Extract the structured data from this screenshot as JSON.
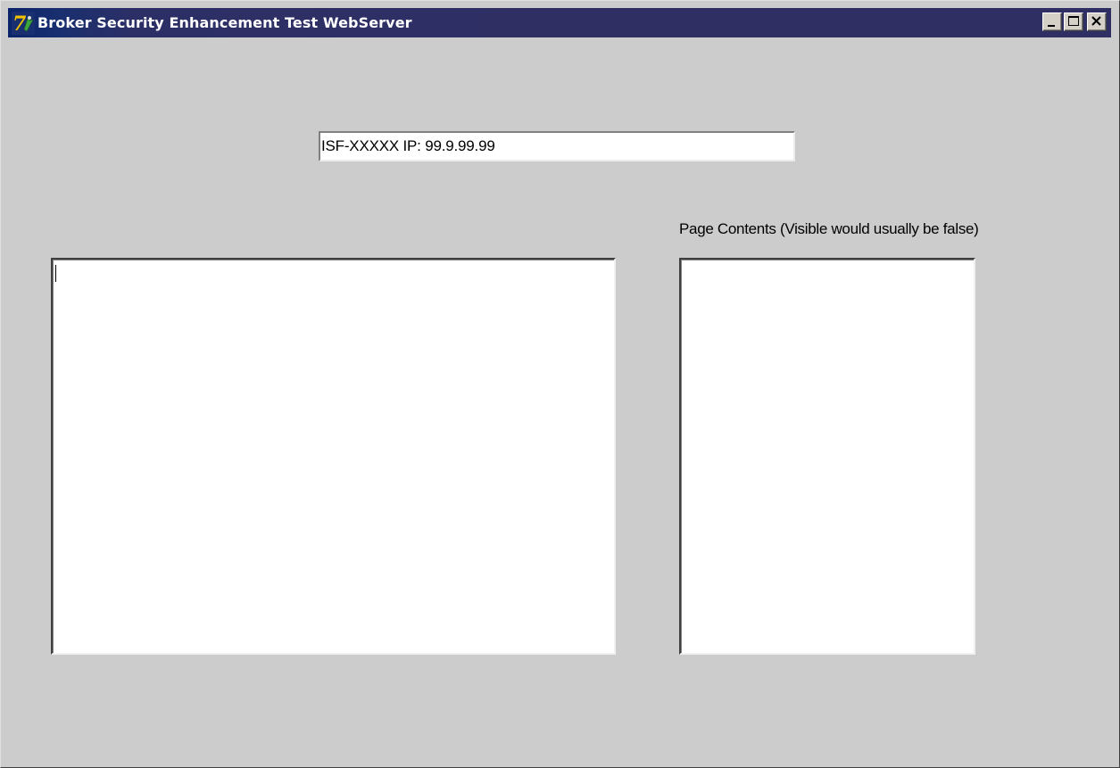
{
  "window": {
    "title": "Broker Security Enhancement Test WebServer",
    "icon": "app-icon"
  },
  "caption_buttons": {
    "minimize_icon": "minimize-icon",
    "maximize_icon": "maximize-icon",
    "close_icon": "close-icon"
  },
  "ip_field": {
    "value": "ISF-XXXXX IP: 99.9.99.99"
  },
  "page_contents": {
    "label": "Page Contents (Visible would usually be false)",
    "value": ""
  },
  "log_memo": {
    "value": ""
  },
  "colors": {
    "titlebar": "#2f2f63",
    "window_bg": "#cccccc",
    "field_bg": "#ffffff"
  }
}
